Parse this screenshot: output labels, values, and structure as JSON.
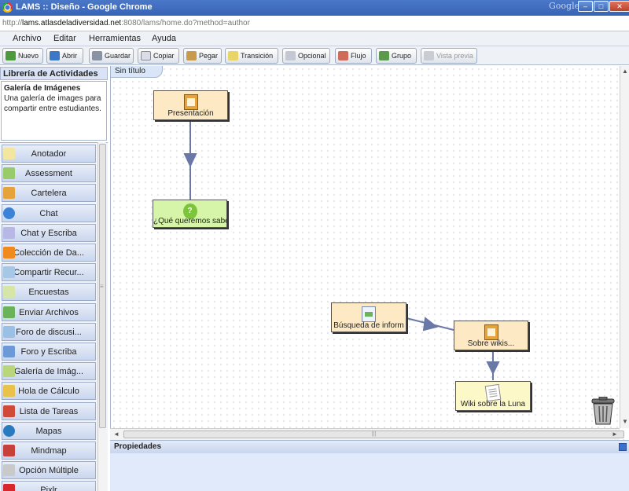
{
  "window": {
    "title": "LAMS :: Diseño - Google Chrome",
    "brand": "Google"
  },
  "url": {
    "host": "lams.atlasdeladiversidad.net",
    "rest": ":8080/lams/home.do?method=author"
  },
  "menu": [
    "Archivo",
    "Editar",
    "Herramientas",
    "Ayuda"
  ],
  "toolbar": [
    {
      "label": "Nuevo",
      "icon": "new-icon",
      "enabled": true
    },
    {
      "label": "Abrir",
      "icon": "open-folder-icon",
      "enabled": true
    },
    {
      "label": "Guardar",
      "icon": "save-icon",
      "enabled": true
    },
    {
      "label": "Copiar",
      "icon": "copy-icon",
      "enabled": true
    },
    {
      "label": "Pegar",
      "icon": "paste-icon",
      "enabled": true
    },
    {
      "label": "Transición",
      "icon": "pencil-icon",
      "enabled": true
    },
    {
      "label": "Opcional",
      "icon": "optional-icon",
      "enabled": true
    },
    {
      "label": "Flujo",
      "icon": "flow-icon",
      "enabled": true
    },
    {
      "label": "Grupo",
      "icon": "group-icon",
      "enabled": true
    },
    {
      "label": "Vista previa",
      "icon": "preview-icon",
      "enabled": false
    }
  ],
  "library": {
    "heading": "Librería de Actividades",
    "selected_title": "Galería de Imágenes",
    "selected_desc": "Una galería de images para compartir entre estudiantes.",
    "items": [
      {
        "label": "Anotador",
        "icon": "notebook-icon"
      },
      {
        "label": "Assessment",
        "icon": "assessment-icon"
      },
      {
        "label": "Cartelera",
        "icon": "noticeboard-icon"
      },
      {
        "label": "Chat",
        "icon": "chat-icon"
      },
      {
        "label": "Chat y Escriba",
        "icon": "chat-scribe-icon"
      },
      {
        "label": "Colección de Da...",
        "icon": "data-collection-icon"
      },
      {
        "label": "Compartir Recur...",
        "icon": "share-resources-icon"
      },
      {
        "label": "Encuestas",
        "icon": "survey-icon"
      },
      {
        "label": "Enviar Archivos",
        "icon": "submit-files-icon"
      },
      {
        "label": "Foro de discusi...",
        "icon": "forum-icon"
      },
      {
        "label": "Foro y Escriba",
        "icon": "forum-scribe-icon"
      },
      {
        "label": "Galería de Imág...",
        "icon": "image-gallery-icon"
      },
      {
        "label": "Hola de Cálculo",
        "icon": "spreadsheet-icon"
      },
      {
        "label": "Lista de Tareas",
        "icon": "task-list-icon"
      },
      {
        "label": "Mapas",
        "icon": "globe-icon"
      },
      {
        "label": "Mindmap",
        "icon": "mindmap-icon"
      },
      {
        "label": "Opción Múltiple",
        "icon": "multiple-choice-icon"
      },
      {
        "label": "Pixlr",
        "icon": "pixlr-icon"
      }
    ]
  },
  "canvas": {
    "tab": "Sin título",
    "nodes": [
      {
        "label": "Presentación",
        "icon": "noticeboard-icon"
      },
      {
        "label": "¿Qué queremos sabe",
        "icon": "question-icon"
      },
      {
        "label": "Búsqueda de inform",
        "icon": "share-resources-icon"
      },
      {
        "label": "Sobre wikis...",
        "icon": "noticeboard-icon"
      },
      {
        "label": "Wiki sobre la Luna",
        "icon": "wiki-icon"
      }
    ]
  },
  "properties": {
    "heading": "Propiedades"
  },
  "colors": {
    "titlebar": "#3763b4",
    "node_orange": "#fde9c4",
    "node_green": "#d6f5a8",
    "node_yellow": "#fdf8c8",
    "connector": "#6a78a8"
  }
}
